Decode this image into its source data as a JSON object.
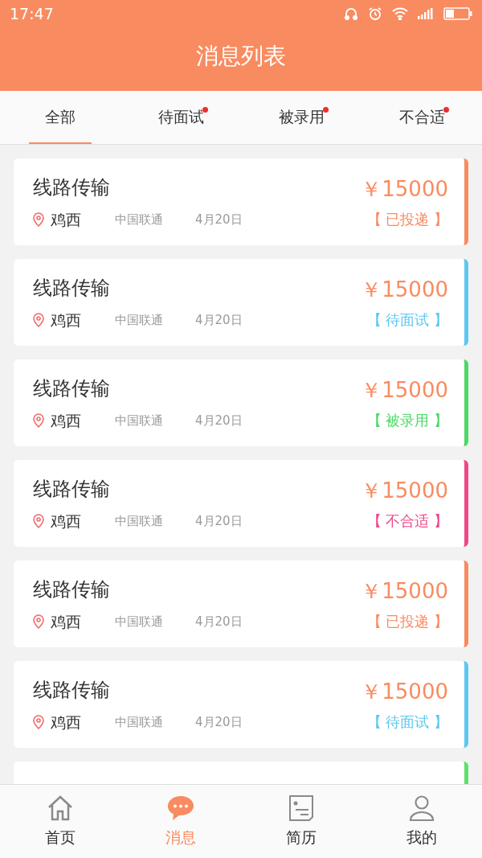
{
  "status_bar": {
    "time": "17:47"
  },
  "header": {
    "title": "消息列表"
  },
  "tabs": [
    {
      "label": "全部",
      "selected": true,
      "badge": false
    },
    {
      "label": "待面试",
      "selected": false,
      "badge": true
    },
    {
      "label": "被录用",
      "selected": false,
      "badge": true
    },
    {
      "label": "不合适",
      "selected": false,
      "badge": true
    }
  ],
  "messages": [
    {
      "title": "线路传输",
      "location": "鸡西",
      "company": "中国联通",
      "date": "4月20日",
      "salary": "￥15000",
      "status": "【 已投递 】",
      "color": "#f98b60"
    },
    {
      "title": "线路传输",
      "location": "鸡西",
      "company": "中国联通",
      "date": "4月20日",
      "salary": "￥15000",
      "status": "【 待面试 】",
      "color": "#5bc8f0"
    },
    {
      "title": "线路传输",
      "location": "鸡西",
      "company": "中国联通",
      "date": "4月20日",
      "salary": "￥15000",
      "status": "【 被录用 】",
      "color": "#4cd964"
    },
    {
      "title": "线路传输",
      "location": "鸡西",
      "company": "中国联通",
      "date": "4月20日",
      "salary": "￥15000",
      "status": "【 不合适 】",
      "color": "#f0478a"
    },
    {
      "title": "线路传输",
      "location": "鸡西",
      "company": "中国联通",
      "date": "4月20日",
      "salary": "￥15000",
      "status": "【 已投递 】",
      "color": "#f98b60"
    },
    {
      "title": "线路传输",
      "location": "鸡西",
      "company": "中国联通",
      "date": "4月20日",
      "salary": "￥15000",
      "status": "【 待面试 】",
      "color": "#5bc8f0"
    },
    {
      "color": "#5ee06a"
    }
  ],
  "bottom_nav": [
    {
      "kind": "home",
      "label": "首页",
      "selected": false
    },
    {
      "kind": "message",
      "label": "消息",
      "selected": true
    },
    {
      "kind": "resume",
      "label": "简历",
      "selected": false
    },
    {
      "kind": "profile",
      "label": "我的",
      "selected": false
    }
  ]
}
